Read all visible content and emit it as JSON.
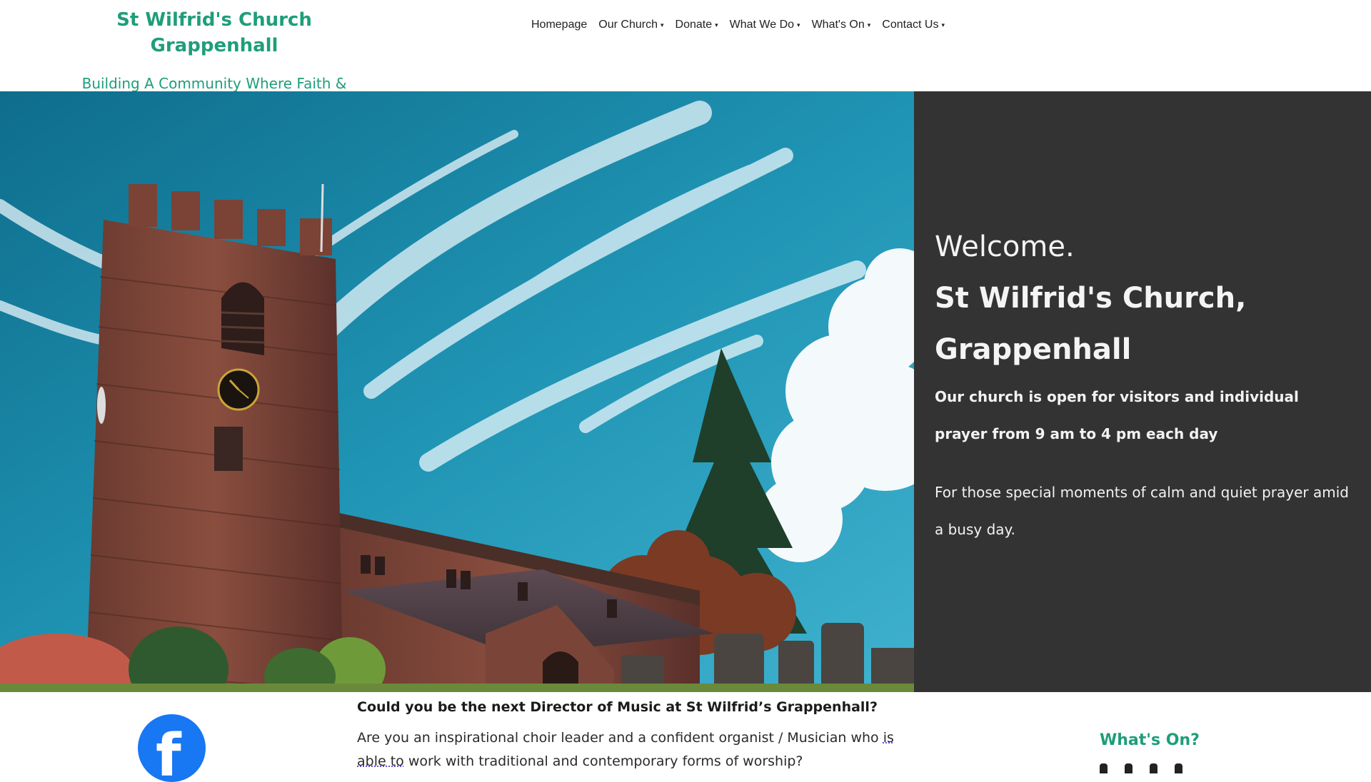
{
  "header": {
    "site_title": "St Wilfrid's Church Grappenhall",
    "tagline": "Building A Community Where Faith & Life Connect"
  },
  "nav": {
    "items": [
      {
        "label": "Homepage",
        "has_menu": false
      },
      {
        "label": "Our Church",
        "has_menu": true
      },
      {
        "label": "Donate",
        "has_menu": true
      },
      {
        "label": "What We Do",
        "has_menu": true
      },
      {
        "label": "What's On",
        "has_menu": true
      },
      {
        "label": "Contact Us",
        "has_menu": true
      }
    ],
    "caret": "▾"
  },
  "hero": {
    "welcome": "Welcome.",
    "church_name_line1": "St Wilfrid's Church,",
    "church_name_line2": "Grappenhall",
    "open_text": "Our church is open for visitors and individual prayer from 9 am to 4 pm each day",
    "calm_text": "For those special moments of calm and quiet prayer amid a busy day."
  },
  "article": {
    "title": "Could you be the next Director of Music at St Wilfrid’s Grappenhall?",
    "body_part1": "Are you an inspirational choir leader and a confident organist / Musician who ",
    "body_link": "is able to",
    "body_part2": " work with traditional and contemporary forms of worship?"
  },
  "sidebar": {
    "whats_on_title": "What's On?"
  },
  "colors": {
    "brand": "#1e9e7a",
    "panel": "#333333",
    "facebook": "#1877f2"
  },
  "icons": {
    "facebook": "facebook-icon"
  }
}
